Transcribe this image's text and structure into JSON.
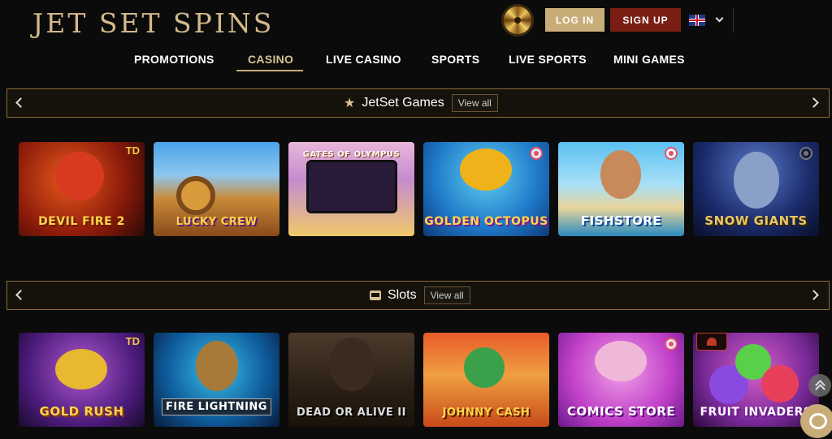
{
  "brand": {
    "logo_text": "JET SET SPINS"
  },
  "header": {
    "wheel_icon": "prize-wheel-icon",
    "login_label": "LOG IN",
    "signup_label": "SIGN UP",
    "language_flag": "uk-flag-icon",
    "colors": {
      "gold": "#c8ad79",
      "signup_red": "#7a1e14",
      "accent_text": "#d9c293"
    }
  },
  "nav": {
    "items": [
      {
        "label": "PROMOTIONS",
        "active": false
      },
      {
        "label": "CASINO",
        "active": true
      },
      {
        "label": "LIVE CASINO",
        "active": false
      },
      {
        "label": "SPORTS",
        "active": false
      },
      {
        "label": "LIVE SPORTS",
        "active": false
      },
      {
        "label": "MINI GAMES",
        "active": false
      }
    ]
  },
  "sections": [
    {
      "title": "JetSet Games",
      "icon": "star-icon",
      "view_all": "View all",
      "games": [
        {
          "title": "DEVIL FIRE 2",
          "badge": "TD"
        },
        {
          "title": "LUCKY CREW",
          "badge": ""
        },
        {
          "title": "GATES OF OLYMPUS",
          "badge": ""
        },
        {
          "title": "GOLDEN OCTOPUS",
          "badge": "target"
        },
        {
          "title": "FISHSTORE",
          "badge": "target"
        },
        {
          "title": "SNOW GIANTS",
          "badge": "target"
        }
      ]
    },
    {
      "title": "Slots",
      "icon": "slot-machine-icon",
      "view_all": "View all",
      "games": [
        {
          "title": "GOLD RUSH",
          "badge": "TD"
        },
        {
          "title": "FIRE LIGHTNING",
          "badge": ""
        },
        {
          "title": "DEAD OR ALIVE II",
          "badge": ""
        },
        {
          "title": "JOHNNY CASH",
          "badge": ""
        },
        {
          "title": "COMICS STORE",
          "badge": "target"
        },
        {
          "title": "FRUIT INVADERS",
          "badge": "provider"
        }
      ]
    }
  ]
}
